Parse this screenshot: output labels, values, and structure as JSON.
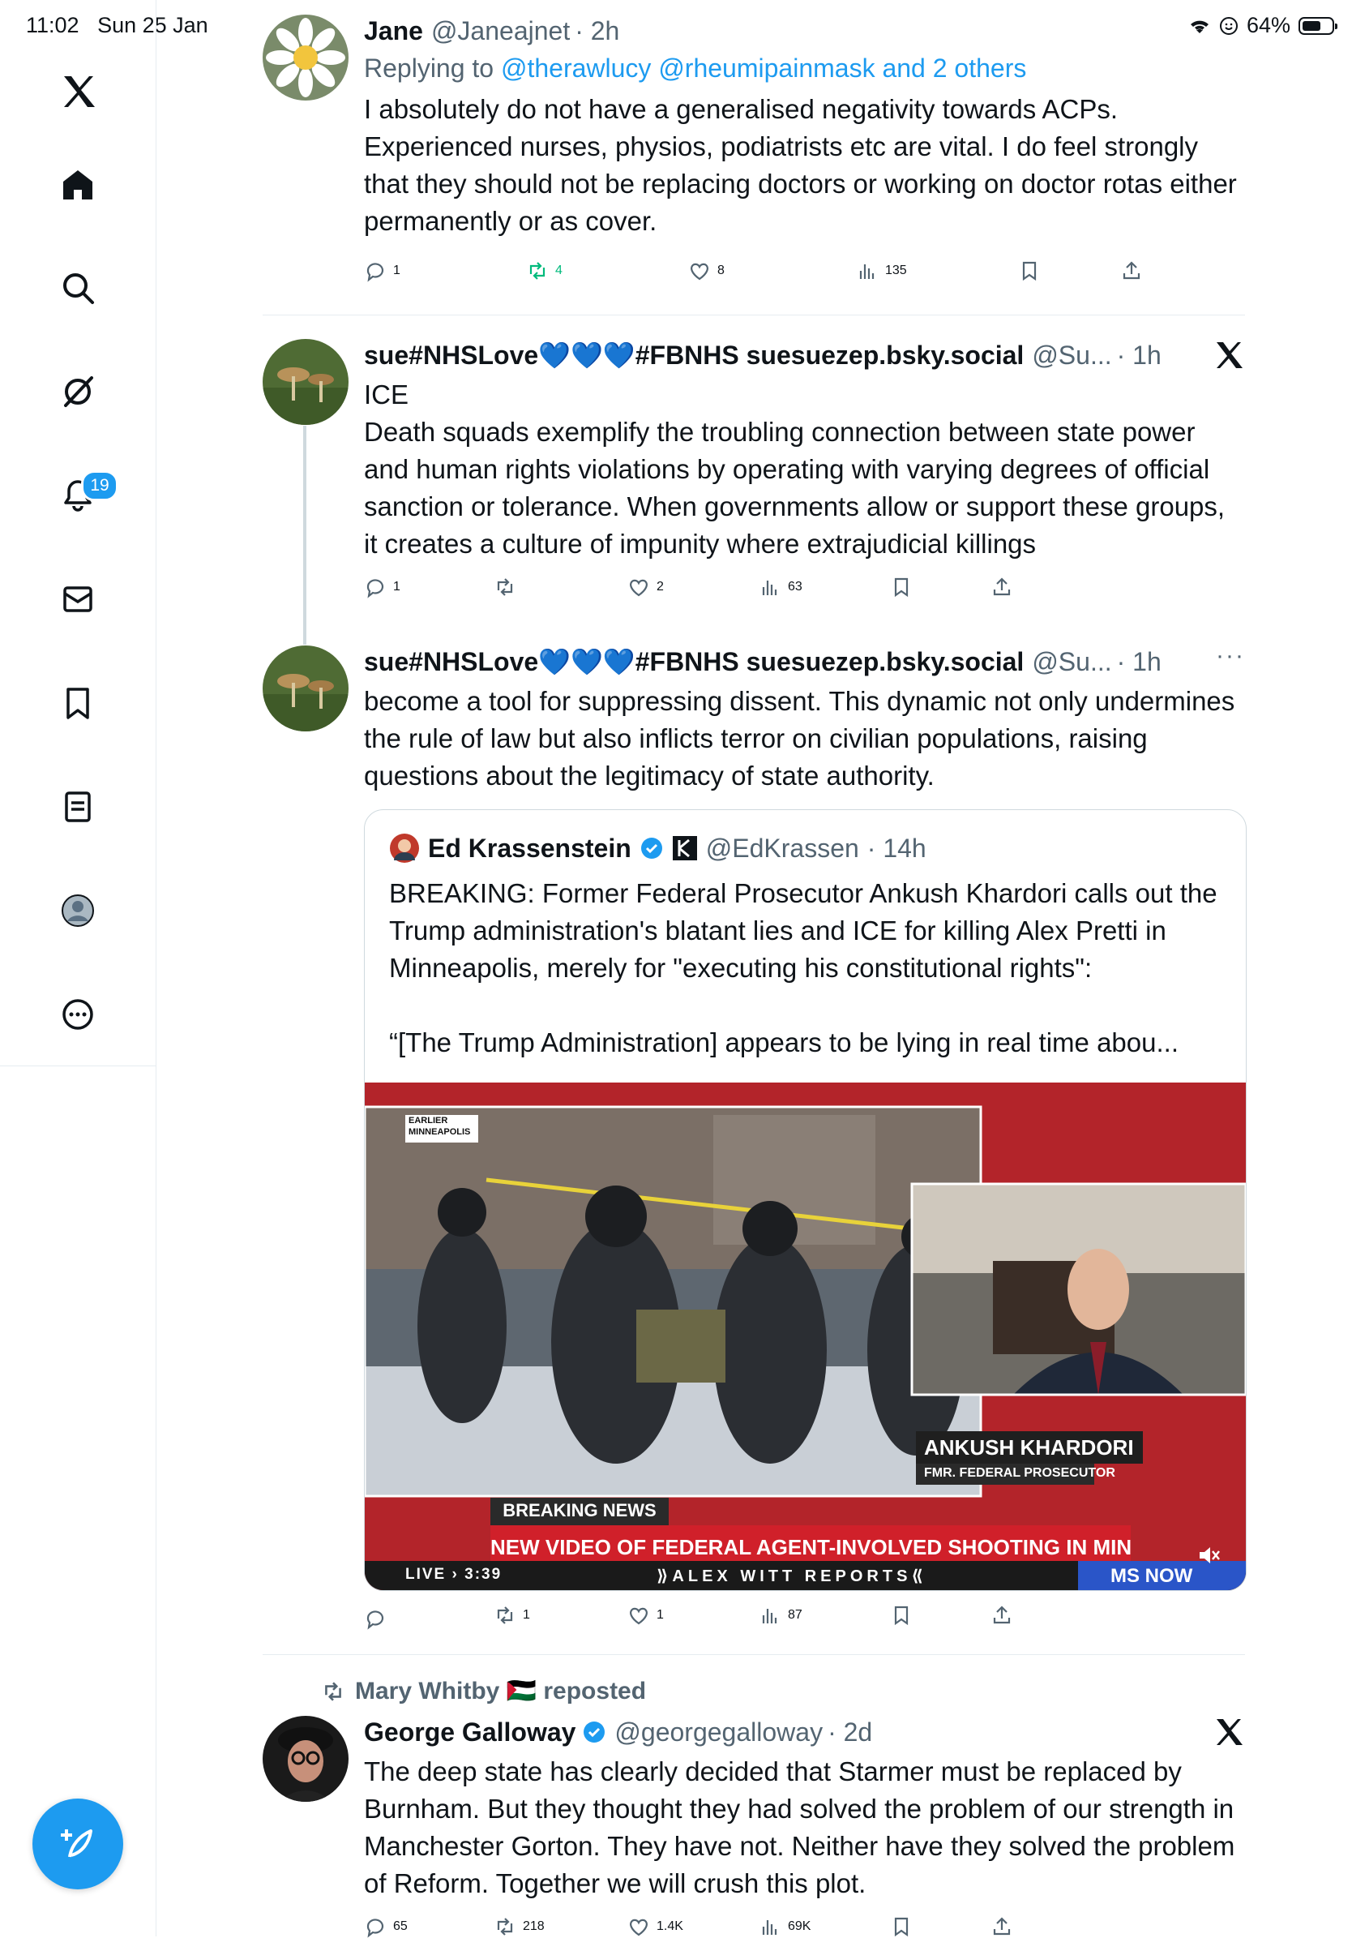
{
  "status_bar": {
    "time": "11:02",
    "date": "Sun 25 Jan",
    "battery": "64%",
    "battery_level": 0.64
  },
  "sidebar": {
    "items": [
      {
        "name": "x-logo-icon"
      },
      {
        "name": "home-icon"
      },
      {
        "name": "search-icon"
      },
      {
        "name": "grok-icon"
      },
      {
        "name": "notifications-icon"
      },
      {
        "name": "messages-icon"
      },
      {
        "name": "bookmarks-icon"
      },
      {
        "name": "lists-icon"
      },
      {
        "name": "profile-icon"
      },
      {
        "name": "more-icon"
      }
    ],
    "notification_count": "19"
  },
  "tweets": [
    {
      "name": "Jane",
      "handle": "@Janeajnet",
      "time": "· 2h",
      "replying_prefix": "Replying to",
      "replying_to": "@therawlucy @rheumipainmask and 2 others",
      "text": "I absolutely do not have a generalised negativity towards ACPs. Experienced nurses, physios, podiatrists etc are vital. I do feel strongly that they should not be replacing doctors or working on doctor rotas either permanently or as cover.",
      "replies": "1",
      "reposts": "4",
      "likes": "8",
      "views": "135"
    },
    {
      "name": "sue#NHSLove💙💙💙#FBNHS suesuezep.bsky.social",
      "handle": "@Su...",
      "time": "· 1h",
      "text": "ICE\nDeath squads exemplify the troubling connection between state power and human rights violations by operating with varying degrees of official sanction or tolerance. When governments allow or support these groups, it creates a culture of impunity where extrajudicial killings",
      "replies": "1",
      "reposts": "",
      "likes": "2",
      "views": "63"
    },
    {
      "name": "sue#NHSLove💙💙💙#FBNHS suesuezep.bsky.social",
      "handle": "@Su...",
      "time": "· 1h",
      "text": "become a tool for suppressing dissent. This dynamic not only undermines the rule of law but also inflicts terror on civilian populations, raising questions about the legitimacy of state authority.",
      "replies": "",
      "reposts": "1",
      "likes": "1",
      "views": "87",
      "quote": {
        "name": "Ed Krassenstein",
        "handle": "@EdKrassen",
        "time": "· 14h",
        "text": "BREAKING: Former Federal Prosecutor Ankush Khardori calls out the Trump administration's blatant lies and ICE for killing Alex Pretti in Minneapolis, merely for \"executing his constitutional rights\":\n\n“[The Trump Administration] appears to be lying in real time abou...",
        "video": {
          "corner_tag": "EARLIER\nMINNEAPOLIS",
          "guest_name": "ANKUSH KHARDORI",
          "guest_title": "FMR. FEDERAL PROSECUTOR",
          "breaking": "BREAKING NEWS",
          "headline": "NEW VIDEO OF FEDERAL AGENT-INVOLVED SHOOTING IN MINNEAPOLIS",
          "live": "LIVE",
          "clock": "3:39",
          "program": "ALEX WITT REPORTS",
          "network": "MS NOW"
        }
      }
    },
    {
      "reposted_by": "Mary Whitby 🇵🇸 reposted",
      "name": "George Galloway",
      "handle": "@georgegalloway",
      "time": "· 2d",
      "text": "The deep state has clearly decided that Starmer must be replaced by Burnham. But they thought they had solved the problem of our strength in Manchester Gorton. They have not. Neither have they solved the problem of Reform. Together we will crush this plot.",
      "replies": "65",
      "reposts": "218",
      "likes": "1.4K",
      "views": "69K"
    }
  ],
  "colors": {
    "accent": "#1d9bf0",
    "text": "#0f1419",
    "muted": "#536471",
    "repost_green": "#00ba7c"
  }
}
